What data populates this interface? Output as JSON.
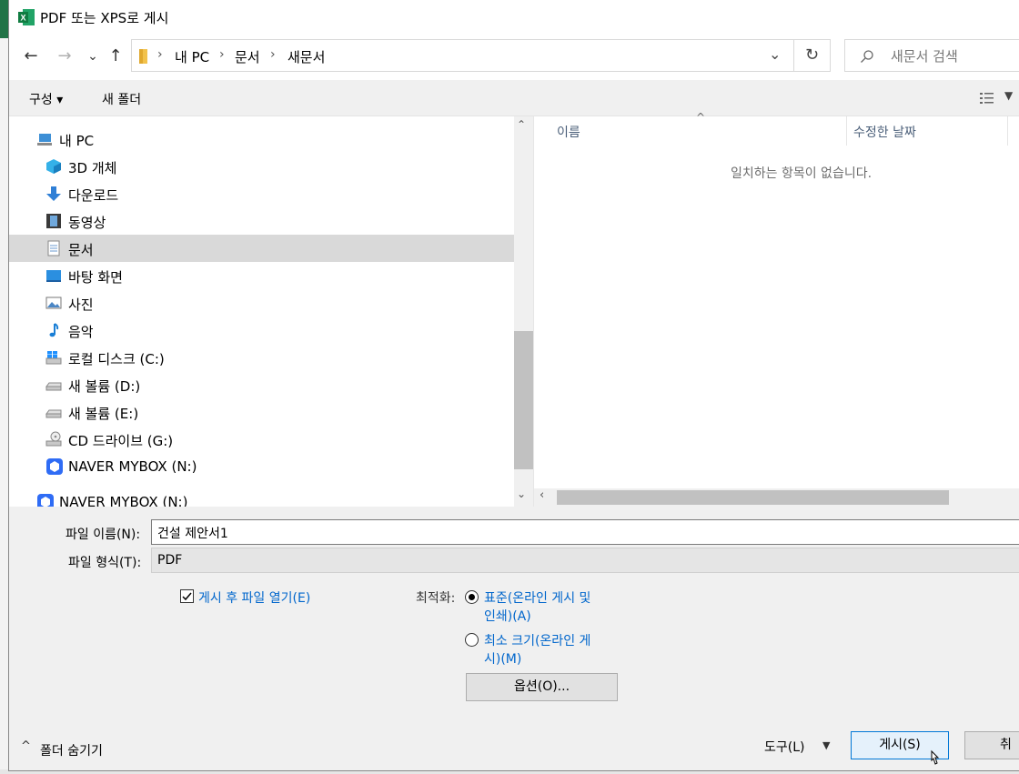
{
  "dialog": {
    "title": "PDF 또는 XPS로 게시"
  },
  "nav": {
    "back_icon": "←",
    "forward_icon": "→",
    "dropdown_icon": "⌄",
    "up_icon": "↑",
    "breadcrumb": [
      "내 PC",
      "문서",
      "새문서"
    ],
    "refresh_icon": "↻",
    "search_placeholder": "새문서 검색"
  },
  "toolbar": {
    "organize_label": "구성 ▾",
    "new_folder_label": "새 폴더"
  },
  "tree": {
    "items": [
      {
        "label": "내 PC",
        "icon": "computer-icon"
      },
      {
        "label": "3D 개체",
        "icon": "cube-icon"
      },
      {
        "label": "다운로드",
        "icon": "download-icon"
      },
      {
        "label": "동영상",
        "icon": "video-icon"
      },
      {
        "label": "문서",
        "icon": "document-icon"
      },
      {
        "label": "바탕 화면",
        "icon": "desktop-icon"
      },
      {
        "label": "사진",
        "icon": "picture-icon"
      },
      {
        "label": "음악",
        "icon": "music-icon"
      },
      {
        "label": "로컬 디스크 (C:)",
        "icon": "windows-drive-icon"
      },
      {
        "label": "새 볼륨 (D:)",
        "icon": "drive-icon"
      },
      {
        "label": "새 볼륨 (E:)",
        "icon": "drive-icon"
      },
      {
        "label": "CD 드라이브 (G:)",
        "icon": "cd-drive-icon"
      },
      {
        "label": "NAVER MYBOX (N:)",
        "icon": "mybox-icon"
      },
      {
        "label": "NAVER MYBOX (N:)",
        "icon": "mybox-icon"
      }
    ],
    "selected_index": 4
  },
  "files": {
    "col_name": "이름",
    "col_modified": "수정한 날짜",
    "empty_text": "일치하는 항목이 없습니다."
  },
  "form": {
    "filename_label": "파일 이름(N):",
    "filename_value": "건설 제안서1",
    "filetype_label": "파일 형식(T):",
    "filetype_value": "PDF",
    "open_after_label": "게시 후 파일 열기(E)",
    "open_after_checked": true,
    "optimize_label": "최적화:",
    "opt_standard_line1": "표준(온라인 게시 및",
    "opt_standard_line2": "인쇄)(A)",
    "opt_min_line1": "최소 크기(온라인 게",
    "opt_min_line2": "시)(M)",
    "options_button": "옵션(O)..."
  },
  "footer": {
    "hide_folders": "폴더 숨기기",
    "tools_label": "도구(L)",
    "publish_button": "게시(S)",
    "cancel_button": "취소"
  },
  "colors": {
    "accent_blue": "#0066cc",
    "excel_green": "#217346",
    "selection_gray": "#d9d9d9"
  }
}
